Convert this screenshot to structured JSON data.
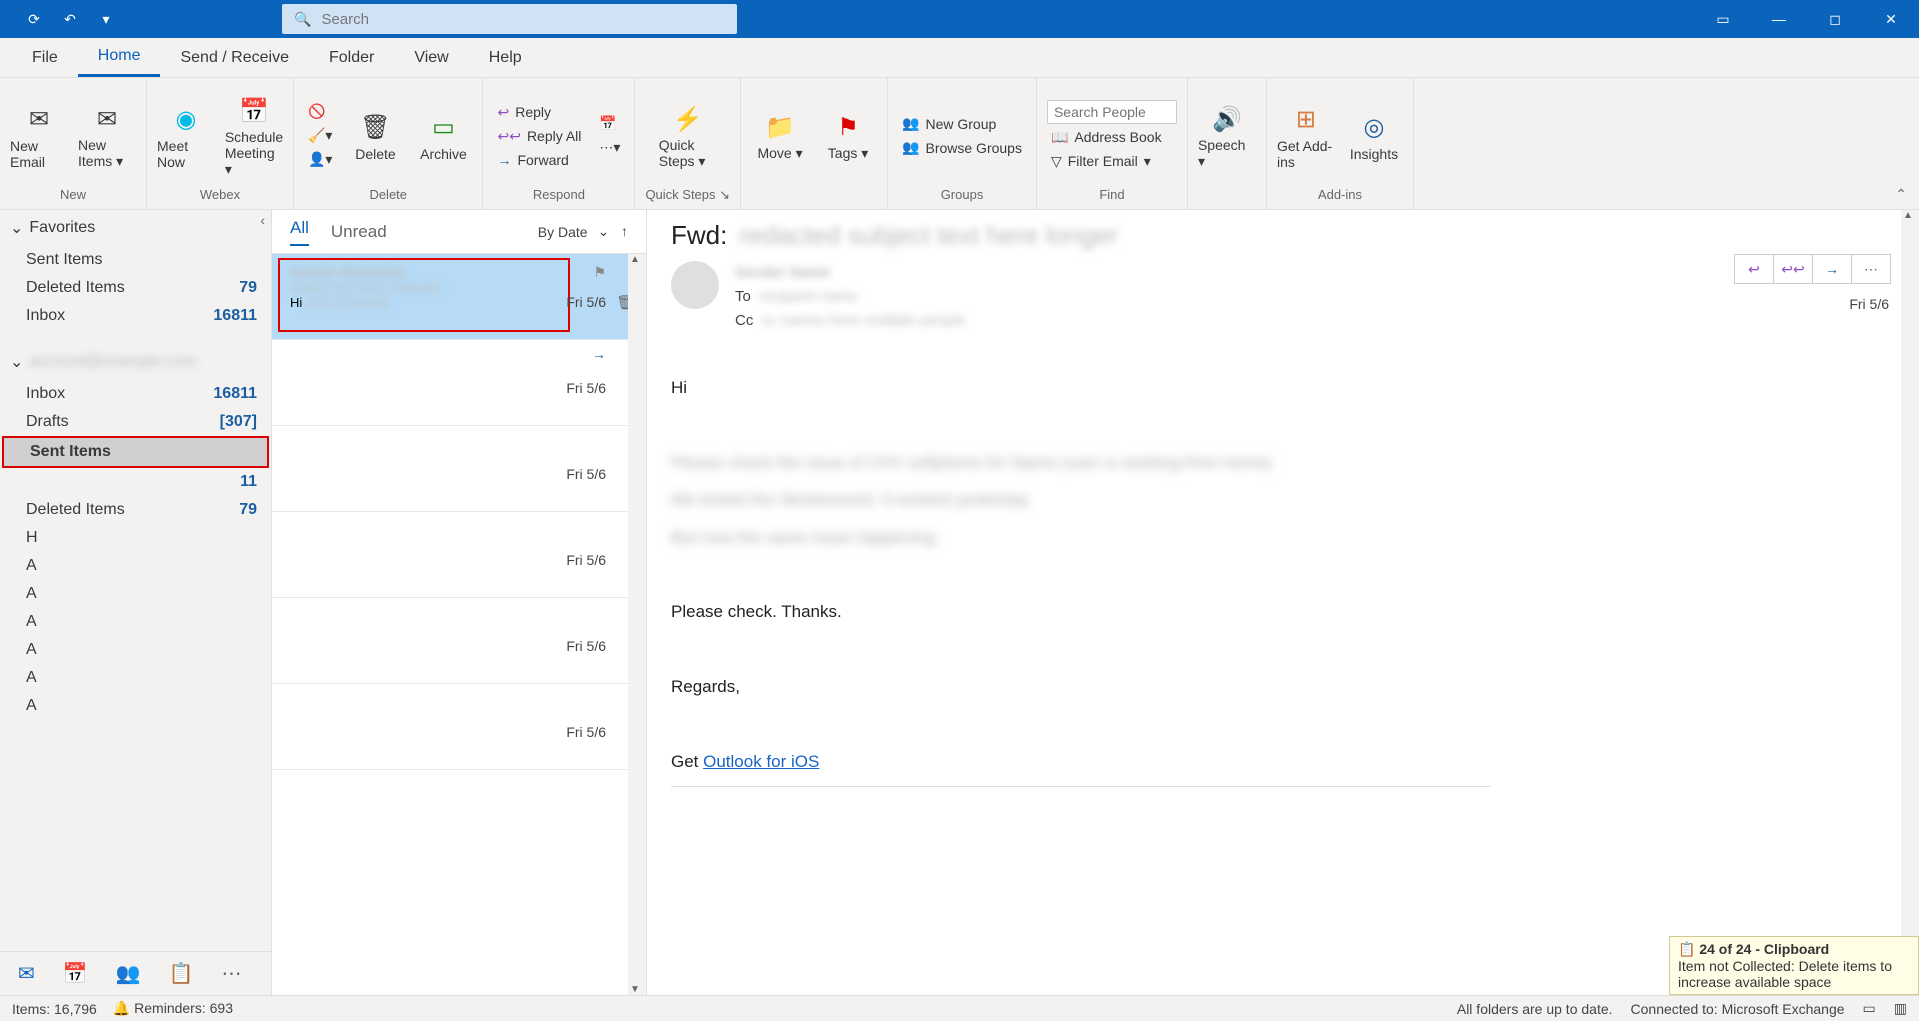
{
  "search_placeholder": "Search",
  "tabs": {
    "file": "File",
    "home": "Home",
    "sendrecv": "Send / Receive",
    "folder": "Folder",
    "view": "View",
    "help": "Help"
  },
  "ribbon": {
    "new": {
      "newEmail": "New Email",
      "newItems": "New Items",
      "label": "New"
    },
    "webex": {
      "meetNow": "Meet Now",
      "schedule": "Schedule Meeting",
      "label": "Webex"
    },
    "delete": {
      "delete": "Delete",
      "archive": "Archive",
      "label": "Delete"
    },
    "respond": {
      "reply": "Reply",
      "replyAll": "Reply All",
      "forward": "Forward",
      "label": "Respond"
    },
    "quicksteps": {
      "quickSteps": "Quick Steps",
      "label": "Quick Steps"
    },
    "move": {
      "move": "Move",
      "tags": "Tags"
    },
    "groups": {
      "newGroup": "New Group",
      "browse": "Browse Groups",
      "label": "Groups"
    },
    "find": {
      "searchPeoplePh": "Search People",
      "addressBook": "Address Book",
      "filter": "Filter Email",
      "label": "Find"
    },
    "speech": {
      "speech": "Speech"
    },
    "addins": {
      "get": "Get Add-ins",
      "insights": "Insights",
      "label": "Add-ins"
    }
  },
  "nav": {
    "favorites": "Favorites",
    "fav_items": [
      {
        "name": "Sent Items",
        "count": ""
      },
      {
        "name": "Deleted Items",
        "count": "79"
      },
      {
        "name": "Inbox",
        "count": "16811"
      }
    ],
    "acct_items": [
      {
        "name": "Inbox",
        "count": "16811"
      },
      {
        "name": "Drafts",
        "count": "[307]"
      },
      {
        "name": "Sent Items",
        "count": ""
      },
      {
        "name": "",
        "count": "11"
      },
      {
        "name": "Deleted Items",
        "count": "79"
      },
      {
        "name": "H",
        "count": ""
      },
      {
        "name": "A",
        "count": ""
      },
      {
        "name": "A",
        "count": ""
      },
      {
        "name": "A",
        "count": ""
      },
      {
        "name": "A",
        "count": ""
      },
      {
        "name": "A",
        "count": ""
      },
      {
        "name": "A",
        "count": ""
      }
    ]
  },
  "mlist": {
    "all": "All",
    "unread": "Unread",
    "sort": "By Date",
    "msgs": [
      {
        "date": "Fri 5/6",
        "preview": "Hi"
      },
      {
        "date": "Fri 5/6"
      },
      {
        "date": "Fri 5/6"
      },
      {
        "date": "Fri 5/6"
      },
      {
        "date": "Fri 5/6"
      },
      {
        "date": "Fri 5/6"
      }
    ]
  },
  "reading": {
    "subjectPrefix": "Fwd:",
    "to": "To",
    "cc": "Cc",
    "date": "Fri 5/6",
    "body": {
      "greet": "Hi",
      "check": "Please check. Thanks.",
      "regards": "Regards,",
      "getPrefix": "Get ",
      "link": "Outlook for iOS"
    }
  },
  "status": {
    "items": "Items: 16,796",
    "reminders": "Reminders: 693",
    "folders": "All folders are up to date.",
    "connected": "Connected to: Microsoft Exchange"
  },
  "toast": {
    "title": "24 of 24 - Clipboard",
    "msg": "Item not Collected: Delete items to increase available space"
  }
}
